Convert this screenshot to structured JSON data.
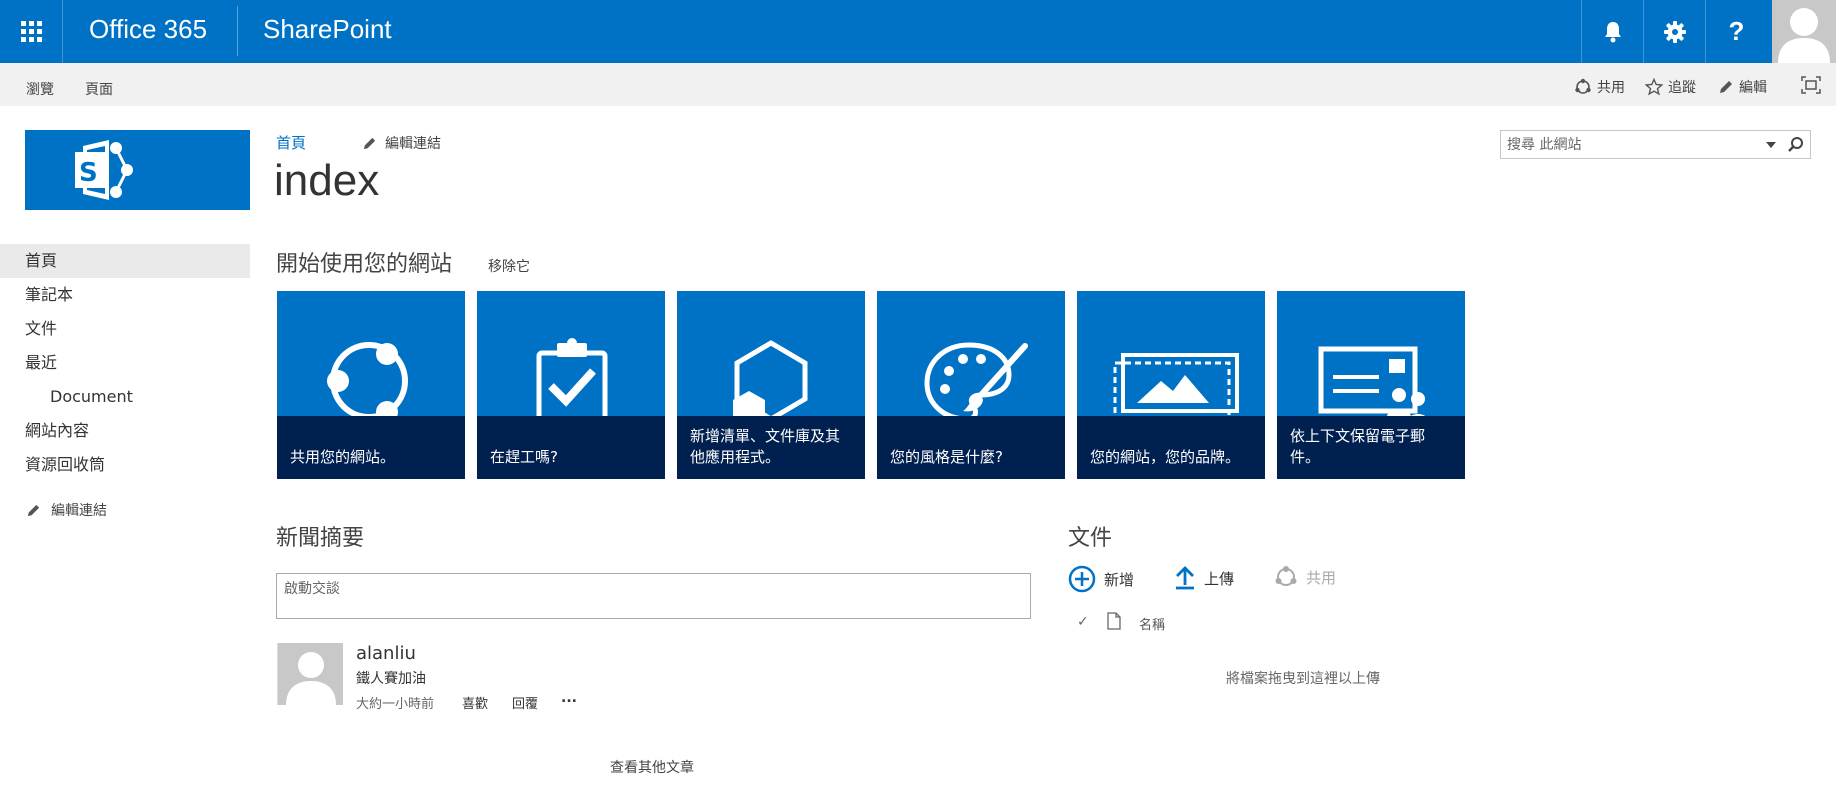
{
  "suite_bar": {
    "brand": "Office 365",
    "app_name": "SharePoint",
    "colors": {
      "bar": "#0072c6"
    },
    "icons": [
      "app-launcher-icon",
      "bell-icon",
      "gear-icon",
      "help-icon",
      "user-avatar"
    ]
  },
  "ribbon": {
    "tabs": [
      "瀏覽",
      "頁面"
    ],
    "actions": {
      "share": "共用",
      "follow": "追蹤",
      "edit": "編輯"
    },
    "icons": [
      "share-icon",
      "star-icon",
      "pencil-icon",
      "focus-icon"
    ]
  },
  "left_nav": {
    "items": [
      {
        "label": "首頁",
        "selected": true
      },
      {
        "label": "筆記本"
      },
      {
        "label": "文件"
      },
      {
        "label": "最近"
      },
      {
        "label": "Document",
        "sub": true
      },
      {
        "label": "網站內容"
      },
      {
        "label": "資源回收筒"
      }
    ],
    "edit_links": "編輯連結"
  },
  "page": {
    "breadcrumb_home": "首頁",
    "edit_links": "編輯連結",
    "title": "index"
  },
  "search": {
    "placeholder": "搜尋 此網站"
  },
  "get_started": {
    "heading": "開始使用您的網站",
    "remove": "移除它",
    "tiles": [
      {
        "label": "共用您的網站。",
        "icon": "share-icon"
      },
      {
        "label": "在趕工嗎?",
        "icon": "clipboard-check-icon"
      },
      {
        "label": "新增清單、文件庫及其他應用程式。",
        "icon": "add-app-icon"
      },
      {
        "label": "您的風格是什麼?",
        "icon": "palette-icon"
      },
      {
        "label": "您的網站，您的品牌。",
        "icon": "picture-icon"
      },
      {
        "label": "依上下文保留電子郵件。",
        "icon": "mail-contacts-icon"
      }
    ],
    "colors": {
      "tile": "#0072c6",
      "tile_label": "#002050"
    }
  },
  "newsfeed": {
    "heading": "新聞摘要",
    "input_placeholder": "啟動交談",
    "post": {
      "author": "alanliu",
      "text": "鐵人賽加油",
      "time": "大約一小時前",
      "like": "喜歡",
      "reply": "回覆",
      "more": "..."
    },
    "see_more": "查看其他文章"
  },
  "documents": {
    "heading": "文件",
    "commands": {
      "new": "新增",
      "upload": "上傳",
      "share": "共用"
    },
    "column_name": "名稱",
    "drop_hint": "將檔案拖曳到這裡以上傳"
  }
}
